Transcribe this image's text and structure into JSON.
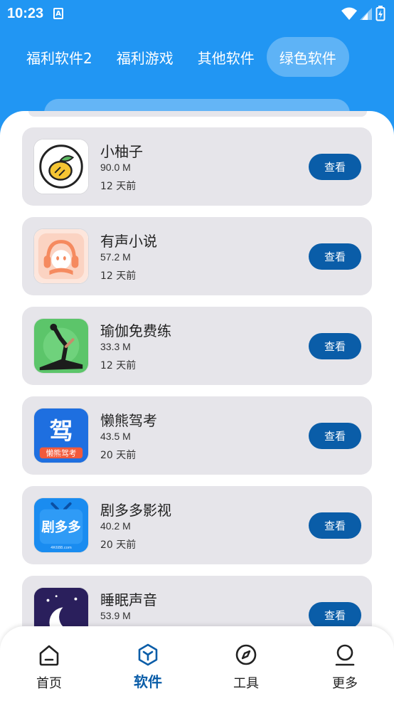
{
  "status": {
    "time": "10:23",
    "notification_letter": "A"
  },
  "tabs": [
    {
      "label": "福利软件2",
      "active": false
    },
    {
      "label": "福利游戏",
      "active": false
    },
    {
      "label": "其他软件",
      "active": false
    },
    {
      "label": "绿色软件",
      "active": true
    }
  ],
  "apps": [
    {
      "name": "小柚子",
      "size": "90.0 M",
      "date": "12 天前",
      "button": "查看",
      "icon": "grapefruit-icon"
    },
    {
      "name": "有声小说",
      "size": "57.2 M",
      "date": "12 天前",
      "button": "查看",
      "icon": "audiobook-icon"
    },
    {
      "name": "瑜伽免费练",
      "size": "33.3 M",
      "date": "12 天前",
      "button": "查看",
      "icon": "yoga-icon"
    },
    {
      "name": "懒熊驾考",
      "size": "43.5 M",
      "date": "20 天前",
      "button": "查看",
      "icon": "driving-exam-icon",
      "icon_text": "驾",
      "icon_subtext": "懒熊驾考"
    },
    {
      "name": "剧多多影视",
      "size": "40.2 M",
      "date": "20 天前",
      "button": "查看",
      "icon": "tv-icon",
      "icon_text": "剧多多",
      "icon_subtext": "4K688.com"
    },
    {
      "name": "睡眠声音",
      "size": "53.9 M",
      "date": "",
      "button": "查看",
      "icon": "moon-icon"
    }
  ],
  "nav": [
    {
      "label": "首页",
      "icon": "home-icon",
      "active": false
    },
    {
      "label": "软件",
      "icon": "cube-icon",
      "active": true
    },
    {
      "label": "工具",
      "icon": "compass-icon",
      "active": false
    },
    {
      "label": "更多",
      "icon": "person-icon",
      "active": false
    }
  ],
  "colors": {
    "header_blue": "#2196f3",
    "button_blue": "#0a5da8",
    "card_gray": "#e6e5ea"
  }
}
